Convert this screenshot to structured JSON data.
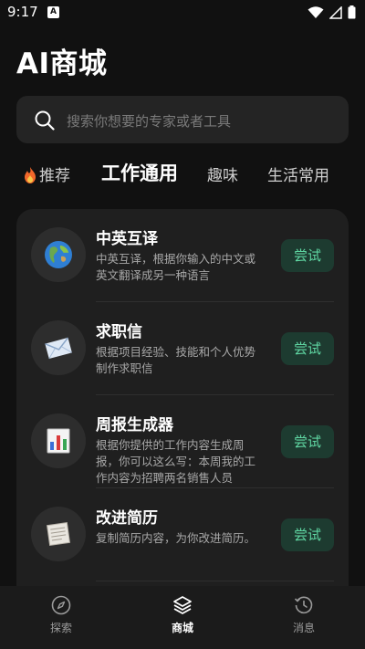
{
  "status_bar": {
    "time": "9:17",
    "notification_icon": "A"
  },
  "app_title": "AI商城",
  "search": {
    "placeholder": "搜索你想要的专家或者工具",
    "icon": "search-icon"
  },
  "tabs": [
    {
      "label": "推荐",
      "icon": "fire-icon",
      "active": false
    },
    {
      "label": "工作通用",
      "active": true
    },
    {
      "label": "趣味",
      "active": false
    },
    {
      "label": "生活常用",
      "active": false
    }
  ],
  "items": [
    {
      "title": "中英互译",
      "description": "中英互译，根据你输入的中文或英文翻译成另一种语言",
      "button": "尝试",
      "icon": "globe-icon"
    },
    {
      "title": "求职信",
      "description": "根据项目经验、技能和个人优势制作求职信",
      "button": "尝试",
      "icon": "envelope-icon"
    },
    {
      "title": "周报生成器",
      "description": "根据你提供的工作内容生成周报，你可以这么写：本周我的工作内容为招聘两名销售人员",
      "button": "尝试",
      "icon": "bar-chart-icon"
    },
    {
      "title": "改进简历",
      "description": "复制简历内容，为你改进简历。",
      "button": "尝试",
      "icon": "document-icon"
    }
  ],
  "bottom_nav": [
    {
      "label": "探索",
      "icon": "compass-icon",
      "active": false
    },
    {
      "label": "商城",
      "icon": "layers-icon",
      "active": true
    },
    {
      "label": "消息",
      "icon": "history-icon",
      "active": false
    }
  ],
  "colors": {
    "background": "#111111",
    "card": "#1f1f1f",
    "accent": "#5fd6a2",
    "button_bg": "#1d3b30"
  }
}
